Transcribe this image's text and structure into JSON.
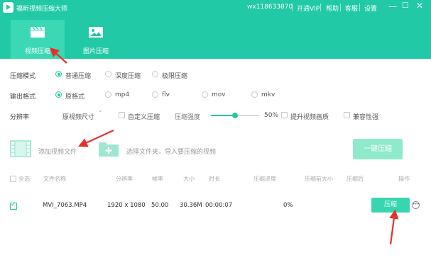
{
  "titlebar": {
    "app_title": "福昕视频压缩大师",
    "user_id": "wx118633870",
    "vip": "开通VIP",
    "help": "帮助",
    "service": "客服",
    "settings": "设置"
  },
  "tabs": [
    {
      "label": "视频压缩",
      "icon": "clapperboard-icon",
      "active": true
    },
    {
      "label": "图片压缩",
      "icon": "image-icon",
      "active": false
    }
  ],
  "options": {
    "mode_label": "压缩模式",
    "modes": [
      "普通压缩",
      "深度压缩",
      "极限压缩"
    ],
    "selected_mode": "普通压缩",
    "format_label": "输出格式",
    "formats": [
      "原格式",
      "mp4",
      "flv",
      "mov",
      "mkv"
    ],
    "selected_format": "原格式",
    "resolution_label": "分辨率",
    "resolution_value": "原视频尺寸",
    "custom_compress": "自定义压缩",
    "strength_label": "压缩强度",
    "strength_value": "50%",
    "strength_fraction": 0.5,
    "enhance_quality": "提升视频画质",
    "compatibility": "兼容性强"
  },
  "addbar": {
    "add_video": "添加视频文件",
    "add_folder": "选择文件夹，导入要压缩的视频",
    "compress_all": "一键压缩"
  },
  "table": {
    "headers": [
      "全选",
      "文件名称",
      "分辨率",
      "帧率",
      "大小",
      "时长",
      "压缩进度",
      "压缩前大小",
      "压缩后",
      "操作"
    ],
    "rows": [
      {
        "name": "MVI_7063.MP4",
        "resolution": "1920 x 1080",
        "fps": "50.00",
        "size": "30.36M",
        "duration": "00:00:07",
        "progress": "0%",
        "action": "压缩"
      }
    ]
  },
  "colors": {
    "brand": "#22c9a6",
    "annotation": "#e5312c"
  }
}
